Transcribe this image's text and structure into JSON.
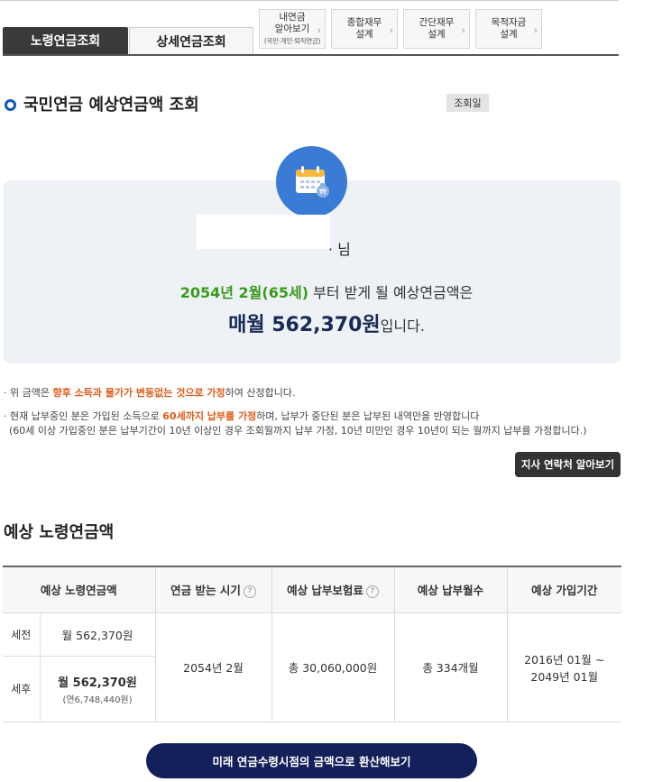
{
  "tabs": {
    "main": [
      "노령연금조회",
      "상세연금조회"
    ],
    "sub": [
      {
        "line1": "내연금",
        "line2": "알아보기",
        "line3": "(국민·개인·퇴직연금)"
      },
      {
        "line1": "종합재무",
        "line2": "설계"
      },
      {
        "line1": "간단재무",
        "line2": "설계"
      },
      {
        "line1": "목적자금",
        "line2": "설계"
      }
    ]
  },
  "section": {
    "title": "국민연금 예상연금액 조회",
    "date_badge": "조회일"
  },
  "result": {
    "name_suffix": "님",
    "start_highlight": "2054년 2월(65세)",
    "start_rest": " 부터 받게 될 예상연금액은",
    "amount_highlight": "매월 562,370원",
    "amount_rest": "입니다."
  },
  "notes": {
    "n1_pre": "· 위 금액은 ",
    "n1_red": "향후 소득과 물가가 변동없는 것으로 가정",
    "n1_post": "하여 산정합니다.",
    "n2_pre": "· 현재 납부중인 분은 가입된 소득으로 ",
    "n2_red": "60세까지 납부를 가정",
    "n2_post": "하며, 납부가 중단된 분은 납부된 내역만을 반영합니다",
    "n3": "(60세 이상 가입중인 분은 납부기간이 10년 이상인 경우 조회월까지 납부 가정, 10년 미만인 경우 10년이 되는 월까지 납부를 가정합니다.)"
  },
  "branch_button": "지사 연락처 알아보기",
  "table": {
    "title": "예상 노령연금액",
    "headers": [
      "예상 노령연금액",
      "연금 받는 시기",
      "예상 납부보험료",
      "예상 납부월수",
      "예상 가입기간"
    ],
    "help_icon": "?",
    "before_label": "세전",
    "before_amount": "월 562,370원",
    "after_label": "세후",
    "after_amount": "월 562,370원",
    "after_annual": "(연6,748,440원)",
    "receive_time": "2054년 2월",
    "premium": "총 30,060,000원",
    "months": "총 334개월",
    "period_start": "2016년 01월 ~",
    "period_end": "2049년 01월"
  },
  "convert_button": "미래 연금수령시점의 금액으로 환산해보기",
  "colors": {
    "accent_green": "#3a9a1a",
    "accent_red": "#e05a1a",
    "navy": "#14205a",
    "icon_blue": "#3a7bd5"
  }
}
